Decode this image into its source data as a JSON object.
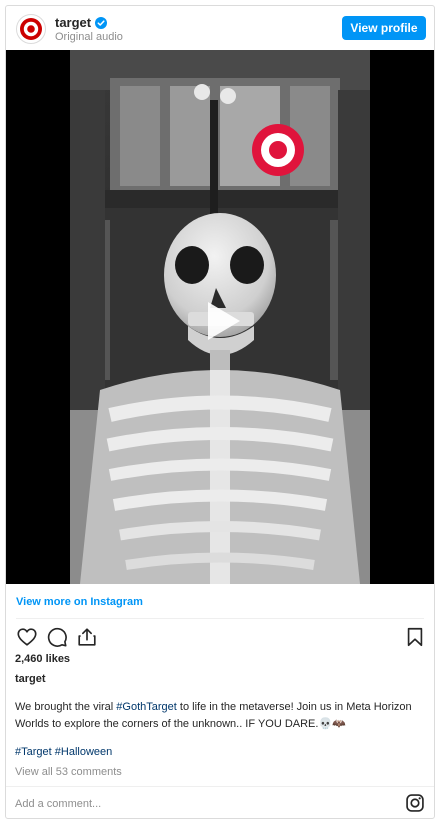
{
  "header": {
    "username": "target",
    "subtitle": "Original audio",
    "view_profile_label": "View profile"
  },
  "post": {
    "view_more_label": "View more on Instagram",
    "likes": "2,460 likes",
    "author": "target",
    "caption_parts": {
      "p1": "We brought the viral ",
      "tag1": "#GothTarget",
      "p2": " to life in the metaverse! Join us in Meta Horizon Worlds to explore the corners of the unknown.. IF YOU DARE.",
      "emoji": "💀🦇"
    },
    "hashtags": [
      "#Target",
      "#Halloween"
    ],
    "view_comments": "View all 53 comments"
  },
  "comment": {
    "placeholder": "Add a comment..."
  },
  "colors": {
    "accent": "#0095f6",
    "brand_red": "#cc0000",
    "hashtag": "#00376b",
    "muted": "#8e8e8e"
  },
  "icons": [
    "target-logo-icon",
    "verified-badge-icon",
    "play-icon",
    "heart-icon",
    "comment-icon",
    "share-icon",
    "bookmark-icon",
    "instagram-icon"
  ]
}
